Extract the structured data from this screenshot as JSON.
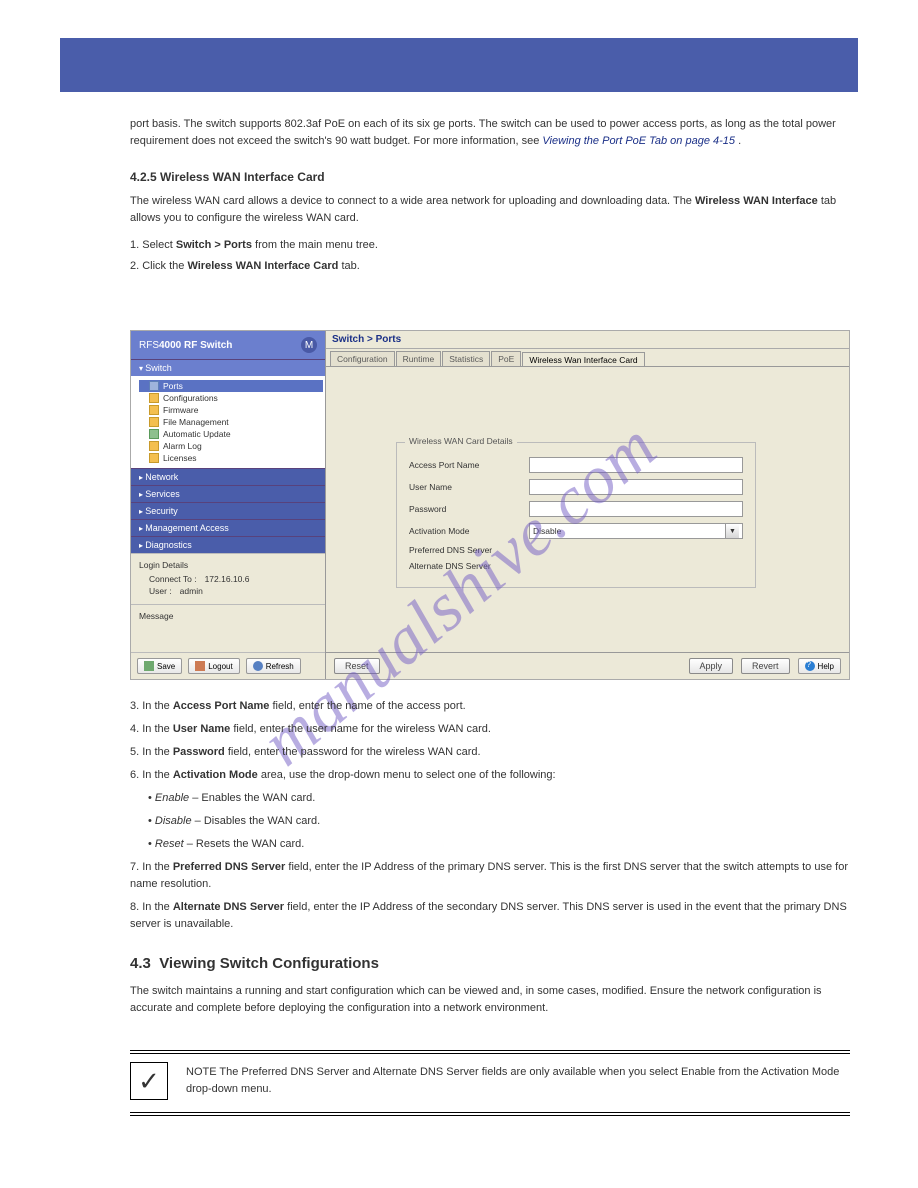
{
  "watermark": "manualshive.com",
  "intro": {
    "p1_a": "port basis. The switch supports 802.3af PoE on each of its six ge ports. The switch can be used to power access ports, as long as the total power requirement does not exceed the switch's 90 watt budget. For more information, see ",
    "p1_link": "Viewing the Port PoE Tab on page 4-15",
    "p1_b": ".",
    "subhead": "4.2.5 Wireless WAN Interface Card",
    "p2_a": "The wireless WAN card allows a device to connect to a wide area network for uploading and downloading data. The ",
    "p2_b": "Wireless WAN Interface",
    "p2_c": " tab allows you to configure the wireless WAN card.",
    "step1_a": "1. Select ",
    "step1_b": "Switch > Ports",
    "step1_c": " from the main menu tree.",
    "step2_a": "2. Click the ",
    "step2_b": "Wireless WAN Interface Card",
    "step2_c": " tab."
  },
  "sidebar": {
    "title_a": "RFS",
    "title_b": "4000 RF Switch",
    "nav_switch": "Switch",
    "tree": {
      "ports": "Ports",
      "configurations": "Configurations",
      "firmware": "Firmware",
      "file_management": "File Management",
      "automatic_update": "Automatic Update",
      "alarm_log": "Alarm Log",
      "licenses": "Licenses"
    },
    "nav_network": "Network",
    "nav_services": "Services",
    "nav_security": "Security",
    "nav_mgmt": "Management Access",
    "nav_diag": "Diagnostics",
    "login_title": "Login Details",
    "connect_label": "Connect To :",
    "connect_val": "172.16.10.6",
    "user_label": "User :",
    "user_val": "admin",
    "message_title": "Message",
    "save_btn": "Save",
    "logout_btn": "Logout",
    "refresh_btn": "Refresh"
  },
  "content": {
    "crumb": "Switch > Ports",
    "tabs": {
      "configuration": "Configuration",
      "runtime": "Runtime",
      "statistics": "Statistics",
      "poe": "PoE",
      "wwan": "Wireless Wan Interface Card"
    },
    "fieldset": {
      "legend": "Wireless WAN Card Details",
      "apn": "Access Port Name",
      "user": "User Name",
      "password": "Password",
      "activation": "Activation Mode",
      "activation_val": "Disable",
      "pref_dns": "Preferred DNS Server",
      "alt_dns": "Alternate DNS Server"
    },
    "reset": "Reset",
    "apply": "Apply",
    "revert": "Revert",
    "help": "Help"
  },
  "after": {
    "s3_a": "3. In the ",
    "s3_b": "Access Port Name",
    "s3_c": " field, enter the name of the access port.",
    "s4_a": "4. In the ",
    "s4_b": "User Name",
    "s4_c": " field, enter the user name for the wireless WAN card.",
    "s5_a": "5. In the ",
    "s5_b": "Password",
    "s5_c": " field, enter the password for the wireless WAN card.",
    "s6_a": "6. In the ",
    "s6_b": "Activation Mode",
    "s6_c": " area, use the drop-down menu to select one of the following:",
    "bul_a_label": "Enable",
    "bul_a_text": " – Enables the WAN card.",
    "bul_b_label": "Disable",
    "bul_b_text": " – Disables the WAN card.",
    "bul_c_label": "Reset",
    "bul_c_text": " – Resets the WAN card.",
    "s7_a": "7. In the ",
    "s7_b": "Preferred DNS Server",
    "s7_c": " field, enter the IP Address of the primary DNS server. This is the first DNS server that the switch attempts to use for name resolution.",
    "s8_a": "8. In the ",
    "s8_b": "Alternate DNS Server",
    "s8_c": " field, enter the IP Address of the secondary DNS server. This DNS server is used in the event that the primary DNS server is unavailable.",
    "finalhead_n": "4.3",
    "finalhead": "Viewing Switch Configurations",
    "finalp": "The switch maintains a running and start configuration which can be viewed and, in some cases, modified. Ensure the network configuration is accurate and complete before deploying the configuration into a network environment."
  },
  "note": {
    "label": "NOTE",
    "text": " The Preferred DNS Server and Alternate DNS Server fields are only available when you select Enable from the Activation Mode drop-down menu."
  }
}
